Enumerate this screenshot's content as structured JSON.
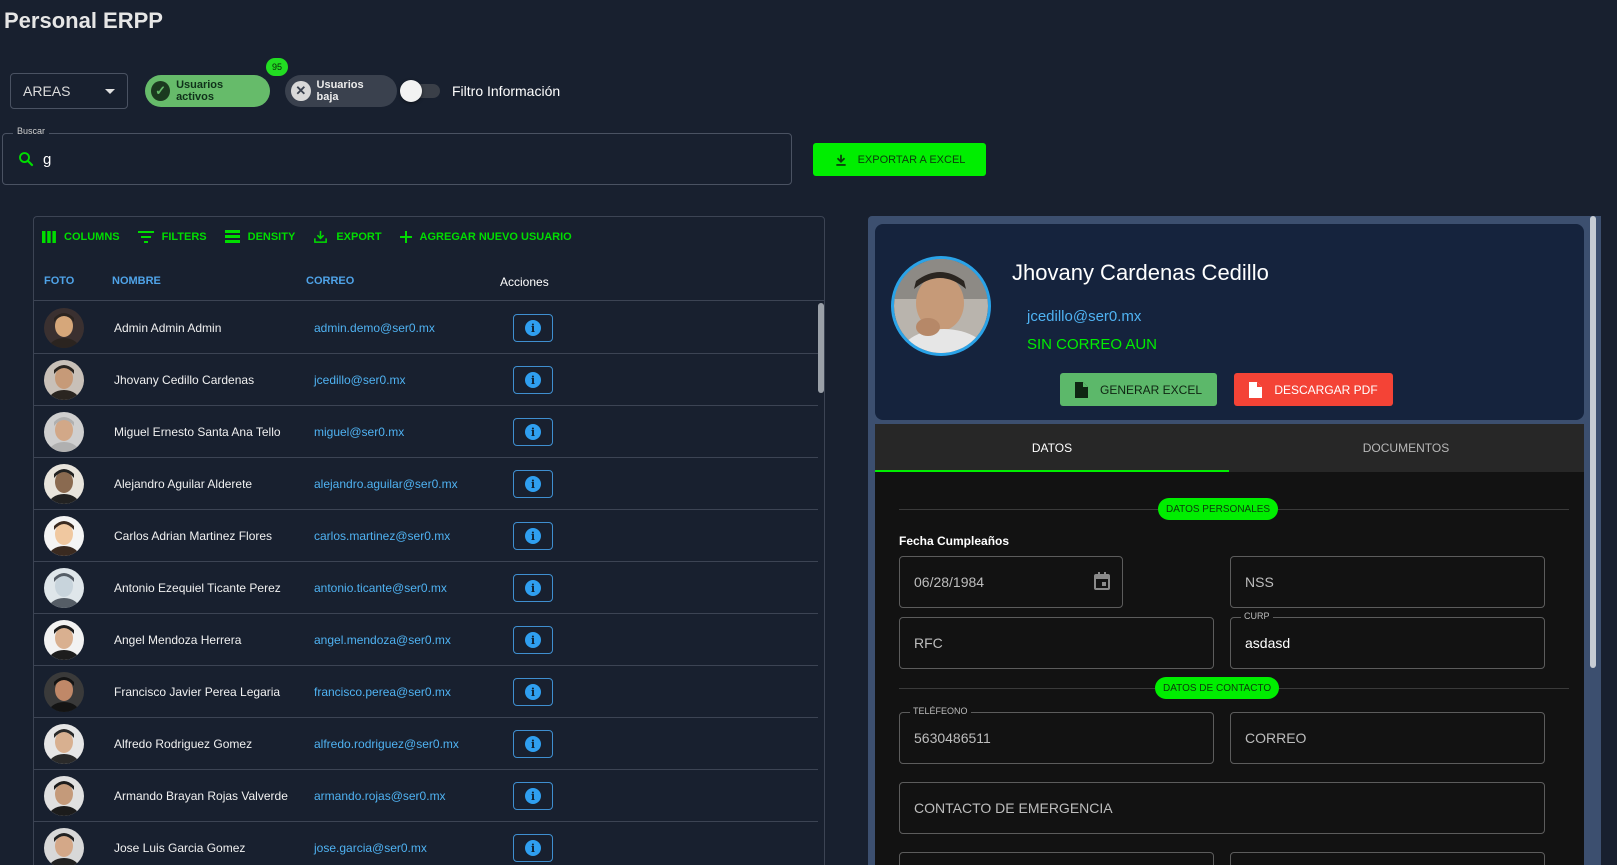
{
  "page": {
    "title": "Personal ERPP"
  },
  "filters": {
    "areas_label": "AREAS",
    "chip_active": "Usuarios activos",
    "chip_active_count": "95",
    "chip_inactive": "Usuarios baja",
    "toggle_label": "Filtro Información"
  },
  "search": {
    "legend": "Buscar",
    "value": "g"
  },
  "export_excel": "EXPORTAR A EXCEL",
  "grid": {
    "toolbar": {
      "columns": "COLUMNS",
      "filters": "FILTERS",
      "density": "DENSITY",
      "export": "EXPORT",
      "add_user": "AGREGAR NUEVO USUARIO"
    },
    "headers": {
      "foto": "FOTO",
      "nombre": "NOMBRE",
      "correo": "CORREO",
      "acciones": "Acciones"
    },
    "rows": [
      {
        "name": "Admin Admin Admin",
        "email": "admin.demo@ser0.mx"
      },
      {
        "name": "Jhovany Cedillo Cardenas",
        "email": "jcedillo@ser0.mx"
      },
      {
        "name": "Miguel Ernesto Santa Ana Tello",
        "email": "miguel@ser0.mx"
      },
      {
        "name": "Alejandro Aguilar Alderete",
        "email": "alejandro.aguilar@ser0.mx"
      },
      {
        "name": "Carlos Adrian Martinez Flores",
        "email": "carlos.martinez@ser0.mx"
      },
      {
        "name": "Antonio Ezequiel Ticante Perez",
        "email": "antonio.ticante@ser0.mx"
      },
      {
        "name": "Angel Mendoza Herrera",
        "email": "angel.mendoza@ser0.mx"
      },
      {
        "name": "Francisco Javier Perea Legaria",
        "email": "francisco.perea@ser0.mx"
      },
      {
        "name": "Alfredo Rodriguez Gomez",
        "email": "alfredo.rodriguez@ser0.mx"
      },
      {
        "name": "Armando Brayan Rojas Valverde",
        "email": "armando.rojas@ser0.mx"
      },
      {
        "name": "Jose Luis Garcia Gomez",
        "email": "jose.garcia@ser0.mx"
      }
    ]
  },
  "profile": {
    "name": "Jhovany Cardenas Cedillo",
    "email": "jcedillo@ser0.mx",
    "alt_email": "SIN CORREO AUN",
    "btn_excel": "GENERAR EXCEL",
    "btn_pdf": "DESCARGAR PDF"
  },
  "tabs": {
    "datos": "DATOS",
    "documentos": "DOCUMENTOS"
  },
  "form": {
    "section_personal": "DATOS PERSONALES",
    "birthday_label": "Fecha Cumpleaños",
    "birthday_value": "06/28/1984",
    "nss": "NSS",
    "rfc": "RFC",
    "curp_label": "CURP",
    "curp_value": "asdasd",
    "section_contact": "DATOS DE CONTACTO",
    "phone_label": "TELÉFEONO",
    "phone_value": "5630486511",
    "correo": "CORREO",
    "emergency": "CONTACTO DE EMERGENCIA"
  },
  "colors": {
    "background": "#18202f",
    "accent_green": "#00ee00",
    "link_blue": "#4fb2f2",
    "pdf_red": "#f44336"
  }
}
